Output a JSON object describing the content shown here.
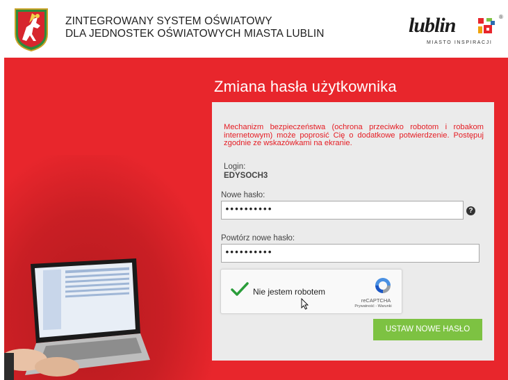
{
  "header": {
    "title_line1": "ZINTEGROWANY SYSTEM OŚWIATOWY",
    "title_line2": "DLA JEDNOSTEK OŚWIATOWYCH MIASTA LUBLIN",
    "coat_of_arms": "coat-of-arms-icon",
    "city_logo": {
      "wordmark": "lublin",
      "tagline": "MIASTO INSPIRACJI",
      "registered": "®"
    }
  },
  "page_title": "Zmiana hasła użytkownika",
  "form": {
    "warning": "Mechanizm bezpieczeństwa (ochrona przeciwko robotom i robakom internetowym) może poprosić Cię o dodatkowe potwierdzenie. Postępuj zgodnie ze wskazówkami na ekranie.",
    "login_label": "Login:",
    "login_value": "EDYSOCH3",
    "new_password_label": "Nowe hasło:",
    "new_password_value": "••••••••••",
    "help_icon": "?",
    "repeat_password_label": "Powtórz nowe hasło:",
    "repeat_password_value": "••••••••••",
    "captcha": {
      "label": "Nie jestem robotem",
      "brand": "reCAPTCHA",
      "links": "Prywatność - Warunki",
      "checked": true
    },
    "submit_label": "USTAW NOWE HASŁO"
  },
  "colors": {
    "brand_red": "#e8262c",
    "warning_red": "#e51c23",
    "button_green": "#7dc242",
    "check_green": "#2a9d3a"
  }
}
